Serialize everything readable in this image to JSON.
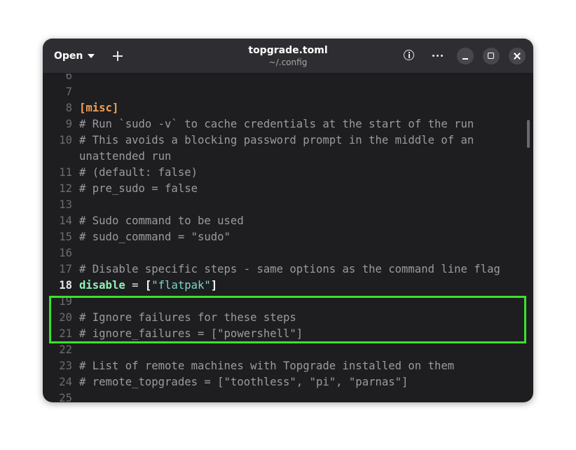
{
  "header": {
    "open_label": "Open",
    "title": "topgrade.toml",
    "subtitle": "~/.config"
  },
  "icons": {
    "open_caret": "caret-down-icon",
    "new_tab": "plus-icon",
    "info": "info-icon",
    "menu": "more-icon",
    "minimize": "minimize-icon",
    "maximize": "maximize-icon",
    "close": "close-icon"
  },
  "colors": {
    "highlight_box": "#39e22b",
    "section": "#f2a054",
    "key": "#8ff0b5",
    "string": "#79d6c6",
    "comment": "#9a9aa0"
  },
  "editor": {
    "active_line": "18",
    "lines": [
      {
        "num": "6",
        "text": ""
      },
      {
        "num": "7",
        "text": ""
      },
      {
        "num": "8",
        "section": "[misc]"
      },
      {
        "num": "9",
        "text": "# Run `sudo -v` to cache credentials at the start of the run"
      },
      {
        "num": "10",
        "text": "# This avoids a blocking password prompt in the middle of an"
      },
      {
        "num": "",
        "text": "unattended run"
      },
      {
        "num": "11",
        "text": "# (default: false)"
      },
      {
        "num": "12",
        "text": "# pre_sudo = false"
      },
      {
        "num": "13",
        "text": ""
      },
      {
        "num": "14",
        "text": "# Sudo command to be used"
      },
      {
        "num": "15",
        "text": "# sudo_command = \"sudo\""
      },
      {
        "num": "16",
        "text": ""
      },
      {
        "num": "17",
        "text": "# Disable specific steps - same options as the command line flag"
      },
      {
        "num": "18",
        "key": "disable",
        "op": " = ",
        "open_bracket": "[",
        "value": "\"flatpak\"",
        "close_bracket": "]"
      },
      {
        "num": "19",
        "text": ""
      },
      {
        "num": "20",
        "text": "# Ignore failures for these steps"
      },
      {
        "num": "21",
        "text": "# ignore_failures = [\"powershell\"]"
      },
      {
        "num": "22",
        "text": ""
      },
      {
        "num": "23",
        "text": "# List of remote machines with Topgrade installed on them"
      },
      {
        "num": "24",
        "text": "# remote_topgrades = [\"toothless\", \"pi\", \"parnas\"]"
      },
      {
        "num": "25",
        "text": ""
      }
    ]
  }
}
